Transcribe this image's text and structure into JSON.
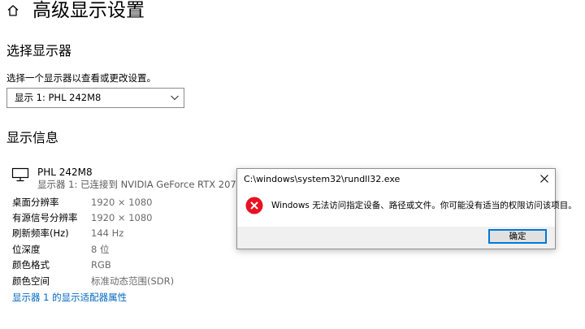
{
  "page": {
    "title": "高级显示设置"
  },
  "select_section": {
    "heading": "选择显示器",
    "label": "选择一个显示器以查看或更改设置。",
    "dropdown_value": "显示 1: PHL 242M8"
  },
  "info_section": {
    "heading": "显示信息",
    "monitor_name": "PHL 242M8",
    "monitor_sub": "显示器 1: 已连接到 NVIDIA GeForce RTX 2070 SUPER",
    "rows": [
      {
        "key": "桌面分辨率",
        "value": "1920 × 1080"
      },
      {
        "key": "有源信号分辨率",
        "value": "1920 × 1080"
      },
      {
        "key": "刷新频率(Hz)",
        "value": "144 Hz"
      },
      {
        "key": "位深度",
        "value": "8 位"
      },
      {
        "key": "颜色格式",
        "value": "RGB"
      },
      {
        "key": "颜色空间",
        "value": "标准动态范围(SDR)"
      }
    ],
    "adapter_link": "显示器 1 的显示适配器属性"
  },
  "dialog": {
    "title": "C:\\windows\\system32\\rundll32.exe",
    "message": "Windows 无法访问指定设备、路径或文件。你可能没有适当的权限访问该项目。",
    "ok_label": "确定"
  },
  "colors": {
    "link": "#0067c0",
    "error_red": "#e81123",
    "button_focus": "#0078d7"
  }
}
